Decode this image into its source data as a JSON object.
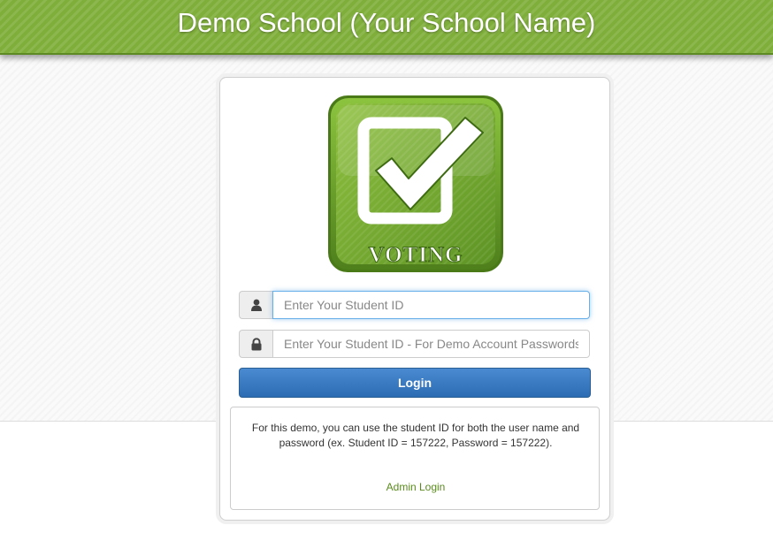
{
  "header": {
    "title": "Demo School (Your School Name)"
  },
  "logo": {
    "text": "VOTING",
    "icon": "checkbox-check-icon"
  },
  "form": {
    "student_id": {
      "icon": "user-icon",
      "placeholder": "Enter Your Student ID",
      "value": ""
    },
    "password": {
      "icon": "lock-icon",
      "placeholder": "Enter Your Student ID - For Demo Account Passwords",
      "value": ""
    },
    "login_label": "Login"
  },
  "info": {
    "text": "For this demo, you can use the student ID for both the user name and password (ex. Student ID = 157222, Password = 157222).",
    "admin_link": "Admin Login"
  },
  "colors": {
    "header_green": "#7fae3a",
    "button_blue": "#2c6cb3",
    "link_green": "#5a8a1c"
  }
}
